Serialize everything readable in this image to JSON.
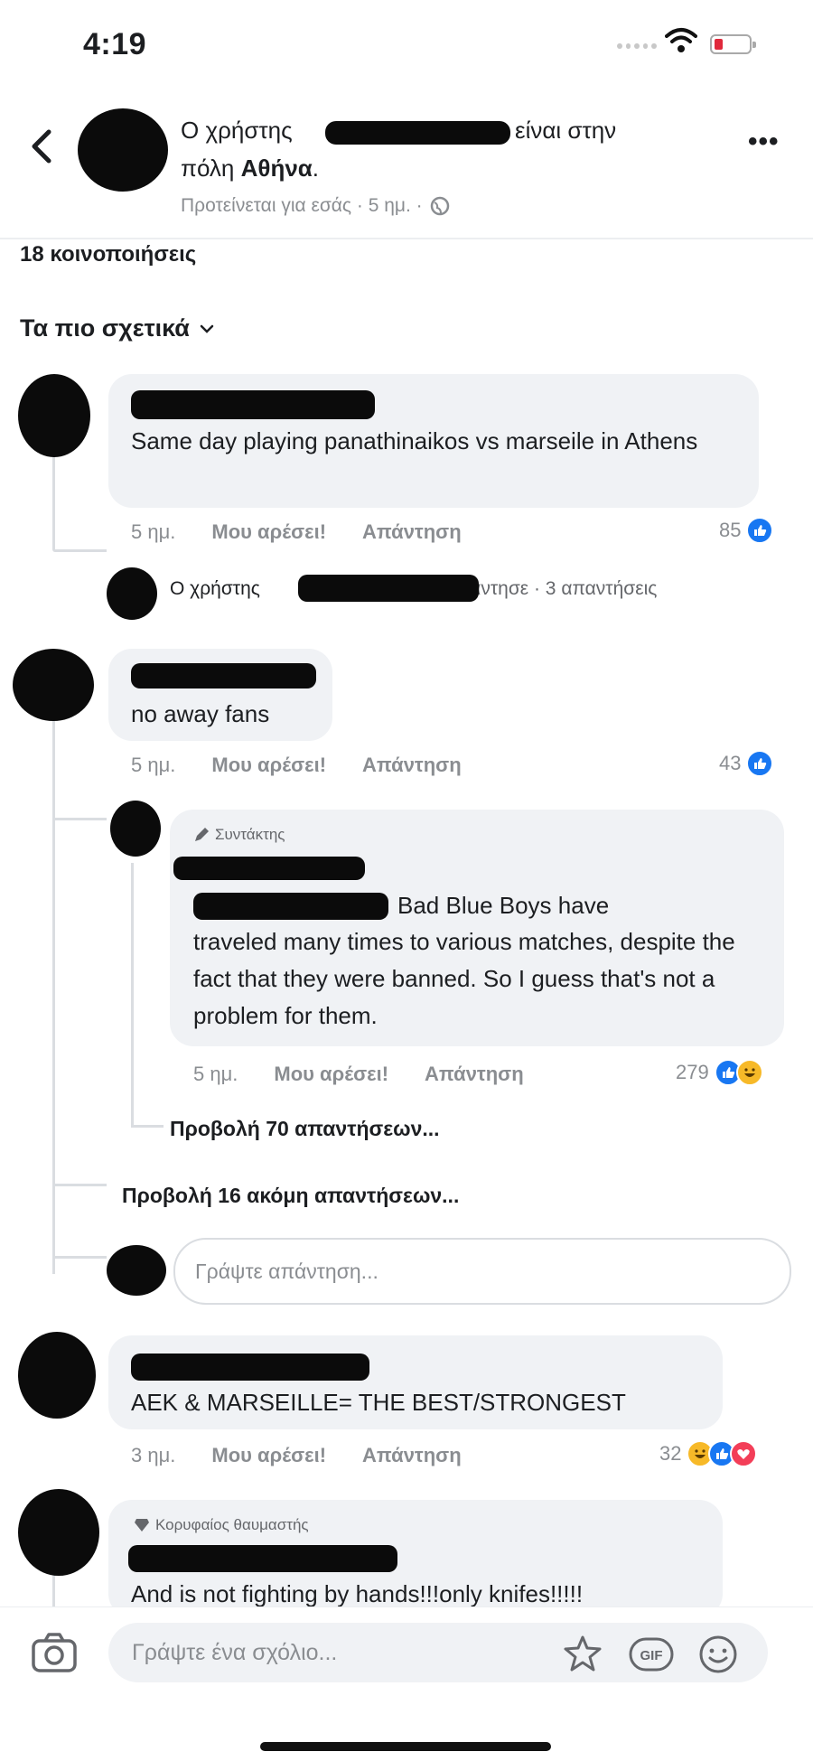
{
  "status_bar": {
    "time": "4:19"
  },
  "header": {
    "line1_prefix": "Ο χρήστης",
    "line1_suffix": "είναι στην",
    "line2_prefix": "πόλη",
    "line2_city": "Αθήνα",
    "line2_end": ".",
    "meta": "Προτείνεται για εσάς · 5 ημ. ·"
  },
  "shares": "18 κοινοποιήσεις",
  "sort_label": "Τα πιο σχετικά",
  "comments": [
    {
      "text": "Same day playing panathinaikos vs marseile in Athens",
      "time": "5 ημ.",
      "like": "Μου αρέσει!",
      "reply": "Απάντηση",
      "count": "85",
      "replies_summary": {
        "prefix": "Ο χρήστης",
        "suffix": "απάντησε · 3 απαντήσεις"
      }
    },
    {
      "text": "no away fans",
      "time": "5 ημ.",
      "like": "Μου αρέσει!",
      "reply": "Απάντηση",
      "count": "43",
      "nested_reply": {
        "badge": "Συντάκτης",
        "text_tail": "Bad Blue Boys have",
        "text_rest": "traveled many times to various matches, despite the fact that they were banned. So I guess that's not a problem for them.",
        "time": "5 ημ.",
        "like": "Μου αρέσει!",
        "reply": "Απάντηση",
        "count": "279"
      },
      "view_replies": "Προβολή 70 απαντήσεων...",
      "view_more": "Προβολή 16 ακόμη απαντήσεων...",
      "reply_placeholder": "Γράψτε απάντηση..."
    },
    {
      "text": "AEK & MARSEILLE= THE BEST/STRONGEST",
      "time": "3 ημ.",
      "like": "Μου αρέσει!",
      "reply": "Απάντηση",
      "count": "32"
    },
    {
      "badge": "Κορυφαίος θαυμαστής",
      "text": "And is not fighting by hands!!!only knifes!!!!!"
    }
  ],
  "composer": {
    "placeholder": "Γράψτε ένα σχόλιο..."
  },
  "colors": {
    "like_blue": "#1877f2",
    "bubble_gray": "#f0f2f5",
    "meta_gray": "#8a8d91"
  }
}
